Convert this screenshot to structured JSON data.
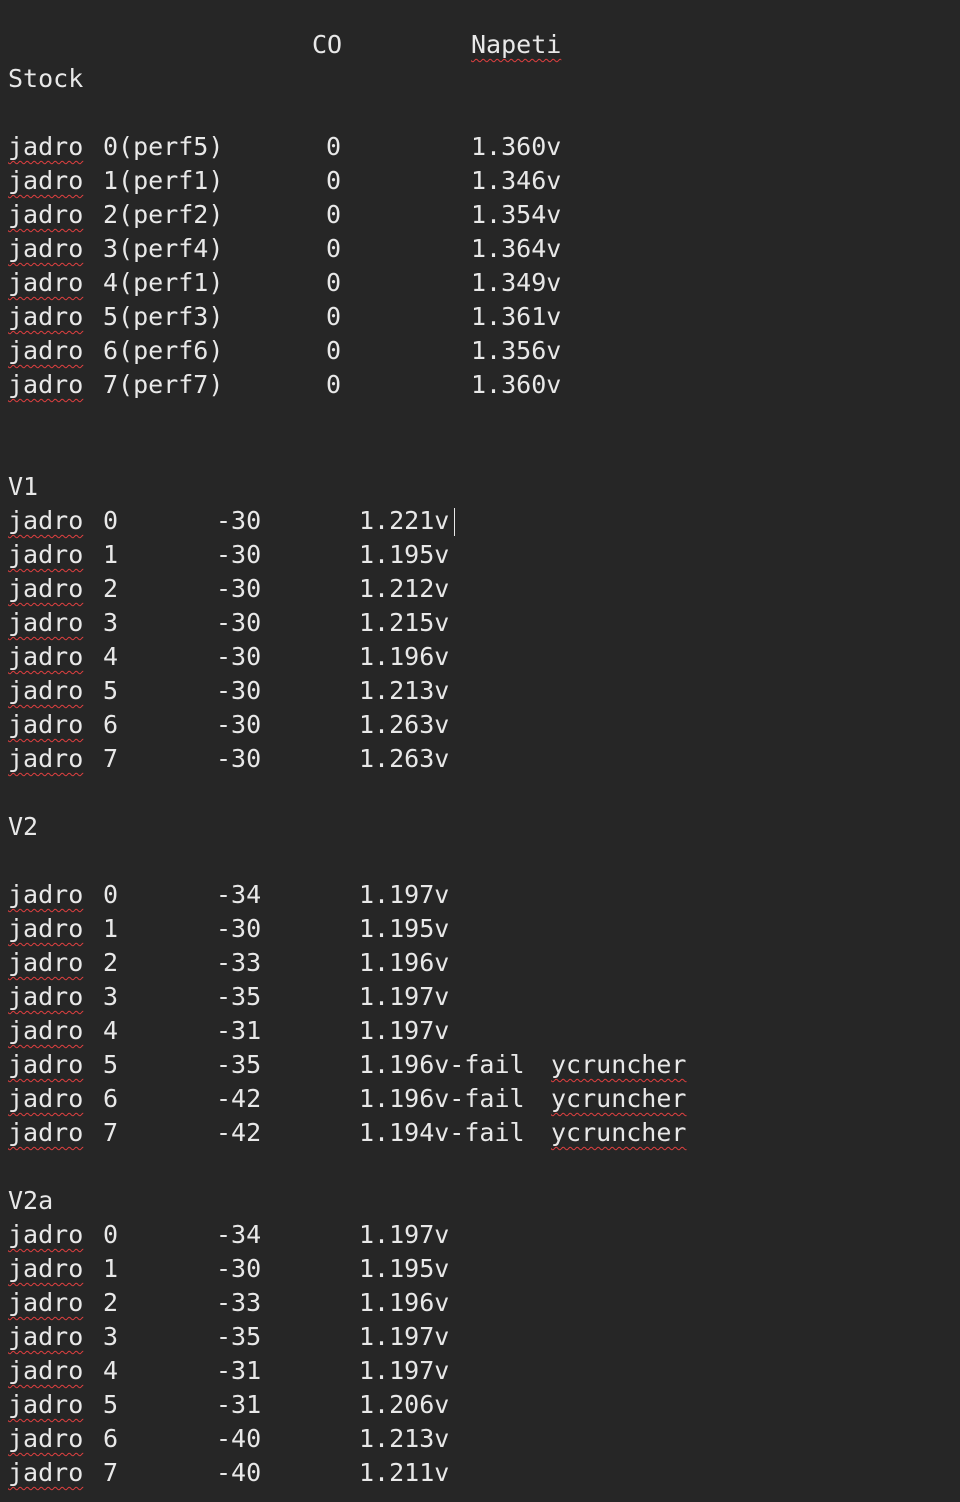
{
  "header": {
    "co_label": "CO",
    "napeti_label": "Napeti"
  },
  "sections": [
    {
      "title": "Stock",
      "rows": [
        {
          "word": "jadro",
          "core": "0(perf5)",
          "co": "0",
          "voltage": "1.360v"
        },
        {
          "word": "jadro",
          "core": "1(perf1)",
          "co": "0",
          "voltage": "1.346v"
        },
        {
          "word": "jadro",
          "core": "2(perf2)",
          "co": "0",
          "voltage": "1.354v"
        },
        {
          "word": "jadro",
          "core": "3(perf4)",
          "co": "0",
          "voltage": "1.364v"
        },
        {
          "word": "jadro",
          "core": "4(perf1)",
          "co": "0",
          "voltage": "1.349v"
        },
        {
          "word": "jadro",
          "core": "5(perf3)",
          "co": "0",
          "voltage": "1.361v"
        },
        {
          "word": "jadro",
          "core": "6(perf6)",
          "co": "0",
          "voltage": "1.356v"
        },
        {
          "word": "jadro",
          "core": "7(perf7)",
          "co": "0",
          "voltage": "1.360v"
        }
      ]
    },
    {
      "title": "V1",
      "rows": [
        {
          "word": "jadro",
          "core": "0",
          "co": "-30",
          "voltage": "1.221v"
        },
        {
          "word": "jadro",
          "core": "1",
          "co": "-30",
          "voltage": "1.195v"
        },
        {
          "word": "jadro",
          "core": "2",
          "co": "-30",
          "voltage": "1.212v"
        },
        {
          "word": "jadro",
          "core": "3",
          "co": "-30",
          "voltage": "1.215v"
        },
        {
          "word": "jadro",
          "core": "4",
          "co": "-30",
          "voltage": "1.196v"
        },
        {
          "word": "jadro",
          "core": "5",
          "co": "-30",
          "voltage": "1.213v"
        },
        {
          "word": "jadro",
          "core": "6",
          "co": "-30",
          "voltage": "1.263v"
        },
        {
          "word": "jadro",
          "core": "7",
          "co": "-30",
          "voltage": "1.263v"
        }
      ]
    },
    {
      "title": "V2",
      "rows": [
        {
          "word": "jadro",
          "core": "0",
          "co": "-34",
          "voltage": "1.197v"
        },
        {
          "word": "jadro",
          "core": "1",
          "co": "-30",
          "voltage": "1.195v"
        },
        {
          "word": "jadro",
          "core": "2",
          "co": "-33",
          "voltage": "1.196v"
        },
        {
          "word": "jadro",
          "core": "3",
          "co": "-35",
          "voltage": "1.197v"
        },
        {
          "word": "jadro",
          "core": "4",
          "co": "-31",
          "voltage": "1.197v"
        },
        {
          "word": "jadro",
          "core": "5",
          "co": "-35",
          "voltage": "1.196v-fail",
          "note": "ycruncher"
        },
        {
          "word": "jadro",
          "core": "6",
          "co": "-42",
          "voltage": "1.196v-fail",
          "note": "ycruncher"
        },
        {
          "word": "jadro",
          "core": "7",
          "co": "-42",
          "voltage": "1.194v-fail",
          "note": "ycruncher"
        }
      ]
    },
    {
      "title": "V2a",
      "rows": [
        {
          "word": "jadro",
          "core": "0",
          "co": "-34",
          "voltage": "1.197v"
        },
        {
          "word": "jadro",
          "core": "1",
          "co": "-30",
          "voltage": "1.195v"
        },
        {
          "word": "jadro",
          "core": "2",
          "co": "-33",
          "voltage": "1.196v"
        },
        {
          "word": "jadro",
          "core": "3",
          "co": "-35",
          "voltage": "1.197v"
        },
        {
          "word": "jadro",
          "core": "4",
          "co": "-31",
          "voltage": "1.197v"
        },
        {
          "word": "jadro",
          "core": "5",
          "co": "-31",
          "voltage": "1.206v"
        },
        {
          "word": "jadro",
          "core": "6",
          "co": "-40",
          "voltage": "1.213v"
        },
        {
          "word": "jadro",
          "core": "7",
          "co": "-40",
          "voltage": "1.211v"
        }
      ]
    }
  ]
}
